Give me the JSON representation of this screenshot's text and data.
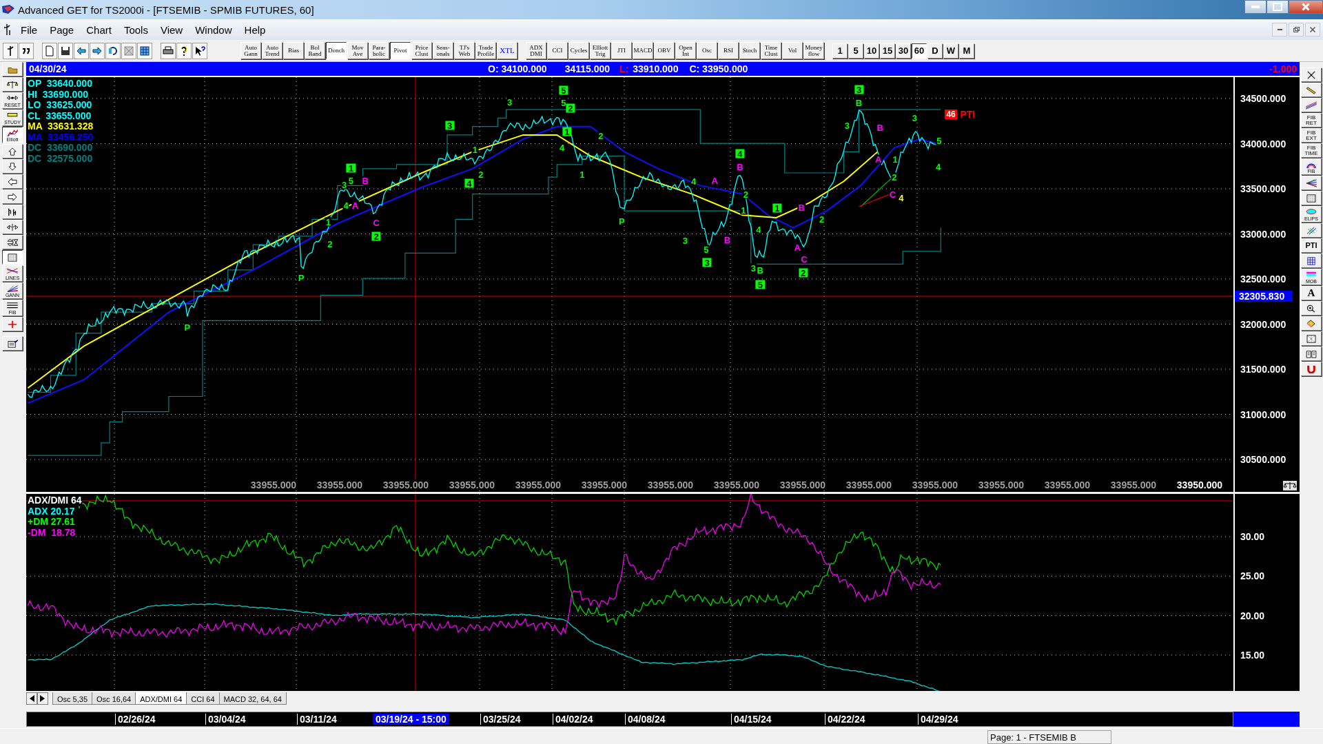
{
  "window": {
    "title": "Advanced GET for TS2000i - [FTSEMIB - SPMIB FUTURES, 60]"
  },
  "menu": [
    "File",
    "Page",
    "Chart",
    "Tools",
    "View",
    "Window",
    "Help"
  ],
  "toolbar": {
    "studies": [
      {
        "label": "Auto\nGann",
        "selected": false
      },
      {
        "label": "Auto\nTrend",
        "selected": false
      },
      {
        "label": "Bias",
        "selected": false
      },
      {
        "label": "Bol\nBand",
        "selected": false
      },
      {
        "label": "Donch",
        "selected": true
      },
      {
        "label": "Mov\nAve",
        "selected": false
      },
      {
        "label": "Para-\nbolic",
        "selected": false
      },
      {
        "label": "Pivot",
        "selected": true
      },
      {
        "label": "Price\nClust",
        "selected": false
      },
      {
        "label": "Seas-\nonals",
        "selected": false
      },
      {
        "label": "TJ's\nWeb",
        "selected": false
      },
      {
        "label": "Trade\nProfile",
        "selected": false
      },
      {
        "label": "XTL",
        "selected": false
      }
    ],
    "indicators": [
      {
        "label": "ADX\nDMI",
        "selected": false
      },
      {
        "label": "CCI",
        "selected": false
      },
      {
        "label": "Cycles",
        "selected": false
      },
      {
        "label": "Elliott\nTrig",
        "selected": false
      },
      {
        "label": "JTI",
        "selected": false
      },
      {
        "label": "MACD",
        "selected": false
      },
      {
        "label": "OBV",
        "selected": false
      },
      {
        "label": "Open\nInt",
        "selected": false
      },
      {
        "label": "Osc",
        "selected": false
      },
      {
        "label": "RSI",
        "selected": false
      },
      {
        "label": "Stoch",
        "selected": false
      },
      {
        "label": "Time\nClust",
        "selected": false
      },
      {
        "label": "Vol",
        "selected": false
      },
      {
        "label": "Money\nflow",
        "selected": false
      }
    ],
    "intervals": [
      {
        "label": "1",
        "selected": false
      },
      {
        "label": "5",
        "selected": false
      },
      {
        "label": "10",
        "selected": false
      },
      {
        "label": "15",
        "selected": false
      },
      {
        "label": "30",
        "selected": false
      },
      {
        "label": "60",
        "selected": true
      },
      {
        "label": "D",
        "selected": false
      },
      {
        "label": "W",
        "selected": false
      },
      {
        "label": "M",
        "selected": false
      }
    ]
  },
  "left_tools": [
    {
      "kind": "folder",
      "selected": false
    },
    {
      "kind": "scales",
      "selected": false
    },
    {
      "kind": "reset",
      "label": "RESET",
      "selected": false
    },
    {
      "kind": "study",
      "label": "STUDY",
      "selected": false
    },
    {
      "kind": "elliott",
      "label": "Elliott",
      "selected": true
    },
    {
      "kind": "up",
      "selected": false
    },
    {
      "kind": "down",
      "selected": false
    },
    {
      "kind": "left",
      "selected": false
    },
    {
      "kind": "right",
      "selected": false
    },
    {
      "kind": "bars",
      "selected": false
    },
    {
      "kind": "hsplit",
      "selected": false
    },
    {
      "kind": "vsplit",
      "selected": false
    },
    {
      "kind": "grid",
      "selected": true
    },
    {
      "kind": "lines",
      "label": "LINES",
      "selected": false
    },
    {
      "kind": "gann",
      "label": "GANN",
      "selected": false
    },
    {
      "kind": "fib",
      "label": "FIB",
      "selected": false
    },
    {
      "kind": "cross",
      "selected": false
    },
    {
      "kind": "notepad",
      "selected": false
    }
  ],
  "right_tools": [
    {
      "kind": "close"
    },
    {
      "kind": "pencil"
    },
    {
      "kind": "parallel"
    },
    {
      "kind": "text",
      "label": "FIB\nRET"
    },
    {
      "kind": "text",
      "label": "FIB\nEXT"
    },
    {
      "kind": "text",
      "label": "FIB\nTIME"
    },
    {
      "kind": "arc",
      "label": "FIB"
    },
    {
      "kind": "fan"
    },
    {
      "kind": "grid"
    },
    {
      "kind": "ellipse",
      "label": "ELIPS"
    },
    {
      "kind": "diagonal"
    },
    {
      "kind": "bold",
      "label": "PTI"
    },
    {
      "kind": "bluegrid"
    },
    {
      "kind": "mob",
      "label": "MOB"
    },
    {
      "kind": "bigtext",
      "label": "A"
    },
    {
      "kind": "zoom"
    },
    {
      "kind": "eraser"
    },
    {
      "kind": "pattern"
    },
    {
      "kind": "book"
    },
    {
      "kind": "magnet"
    }
  ],
  "info_bar": {
    "date": "04/30/24",
    "open": "O: 34100.000",
    "high": "34115.000",
    "low_label": "L:",
    "low": "33910.000",
    "close": "C: 33950.000",
    "change": "-1.000"
  },
  "price_panel": {
    "legend": [
      {
        "label": "OP",
        "value": "33640.000",
        "color": "#00ffff"
      },
      {
        "label": "HI",
        "value": "33690.000",
        "color": "#00ffff"
      },
      {
        "label": "LO",
        "value": "33625.000",
        "color": "#00ffff"
      },
      {
        "label": "CL",
        "value": "33655.000",
        "color": "#00ffff"
      },
      {
        "label": "MA",
        "value": "33631.328",
        "color": "#ffff00"
      },
      {
        "label": "MA",
        "value": "33456.250",
        "color": "#0000ff"
      },
      {
        "label": "DC",
        "value": "33690.000",
        "color": "#008080"
      },
      {
        "label": "DC",
        "value": "32575.000",
        "color": "#008080"
      }
    ],
    "y_axis": [
      "34500.000",
      "34000.000",
      "33500.000",
      "33000.000",
      "32500.000",
      "32000.000",
      "31500.000",
      "31000.000",
      "30500.000"
    ],
    "cursor_price": "32305.830",
    "bottom_values": [
      "33955.000",
      "33955.000",
      "33955.000",
      "33955.000",
      "33955.000",
      "33955.000",
      "33955.000",
      "33955.000",
      "33955.000",
      "33955.000",
      "33955.000",
      "33955.000",
      "33955.000",
      "33955.000",
      "33950.000"
    ],
    "wave_labels": [
      {
        "text": "5",
        "kind": "boxed",
        "color": "#00ff00"
      },
      {
        "text": "3",
        "kind": "boxed",
        "color": "#00ff00"
      },
      {
        "text": "3",
        "kind": "plain",
        "color": "#00ff00"
      },
      {
        "text": "5",
        "kind": "plain",
        "color": "#00ff00"
      },
      {
        "text": "2",
        "kind": "boxed",
        "color": "#00ff00"
      },
      {
        "text": "B",
        "kind": "plain",
        "color": "#00ff00"
      },
      {
        "text": "3",
        "kind": "plain",
        "color": "#00ff00"
      },
      {
        "text": "3",
        "kind": "boxed",
        "color": "#00ff00"
      },
      {
        "text": "1",
        "kind": "boxed",
        "color": "#00ff00"
      },
      {
        "text": "3",
        "kind": "plain",
        "color": "#00ff00"
      },
      {
        "text": "B",
        "kind": "plain",
        "color": "#ff00ff"
      },
      {
        "text": "2",
        "kind": "plain",
        "color": "#00ff00"
      },
      {
        "text": "1",
        "kind": "plain",
        "color": "#00ff00"
      },
      {
        "text": "4",
        "kind": "plain",
        "color": "#00ff00"
      },
      {
        "text": "5",
        "kind": "plain",
        "color": "#00ff00"
      },
      {
        "text": "4",
        "kind": "boxed",
        "color": "#00ff00"
      },
      {
        "text": "A",
        "kind": "plain",
        "color": "#ff00ff"
      },
      {
        "text": "1",
        "kind": "plain",
        "color": "#00ff00"
      },
      {
        "text": "1",
        "kind": "boxed",
        "color": "#00ff00"
      },
      {
        "text": "B",
        "kind": "plain",
        "color": "#ff00ff"
      },
      {
        "text": "4",
        "kind": "plain",
        "color": "#00ff00"
      },
      {
        "text": "2",
        "kind": "plain",
        "color": "#00ff00"
      },
      {
        "text": "1",
        "kind": "plain",
        "color": "#00ff00"
      },
      {
        "text": "2",
        "kind": "plain",
        "color": "#00ff00"
      },
      {
        "text": "3",
        "kind": "plain",
        "color": "#00ff00"
      },
      {
        "text": "5",
        "kind": "plain",
        "color": "#00ff00"
      },
      {
        "text": "B",
        "kind": "plain",
        "color": "#ff00ff"
      },
      {
        "text": "4",
        "kind": "boxed",
        "color": "#00ff00"
      },
      {
        "text": "4",
        "kind": "plain",
        "color": "#00ff00"
      },
      {
        "text": "A",
        "kind": "plain",
        "color": "#ff00ff"
      },
      {
        "text": "2",
        "kind": "plain",
        "color": "#00ff00"
      },
      {
        "text": "C",
        "kind": "plain",
        "color": "#ff00ff"
      },
      {
        "text": "4",
        "kind": "plain",
        "color": "#ffff00"
      },
      {
        "text": "4",
        "kind": "plain",
        "color": "#00ff00"
      },
      {
        "text": "A",
        "kind": "plain",
        "color": "#ff00ff"
      },
      {
        "text": "1",
        "kind": "plain",
        "color": "#00ff00"
      },
      {
        "text": "1",
        "kind": "boxed",
        "color": "#00ff00"
      },
      {
        "text": "B",
        "kind": "plain",
        "color": "#ff00ff"
      },
      {
        "text": "1",
        "kind": "plain",
        "color": "#00ff00"
      },
      {
        "text": "C",
        "kind": "plain",
        "color": "#ff00ff"
      },
      {
        "text": "P",
        "kind": "plain",
        "color": "#00ff00"
      },
      {
        "text": "2",
        "kind": "plain",
        "color": "#00ff00"
      },
      {
        "text": "4",
        "kind": "plain",
        "color": "#00ff00"
      },
      {
        "text": "2",
        "kind": "plain",
        "color": "#00ff00"
      },
      {
        "text": "2",
        "kind": "boxed",
        "color": "#00ff00"
      },
      {
        "text": "3",
        "kind": "plain",
        "color": "#00ff00"
      },
      {
        "text": "5",
        "kind": "plain",
        "color": "#00ff00"
      },
      {
        "text": "B",
        "kind": "plain",
        "color": "#ff00ff"
      },
      {
        "text": "A",
        "kind": "plain",
        "color": "#ff00ff"
      },
      {
        "text": "3",
        "kind": "boxed",
        "color": "#00ff00"
      },
      {
        "text": "3",
        "kind": "plain",
        "color": "#00ff00"
      },
      {
        "text": "B",
        "kind": "plain",
        "color": "#00ff00"
      },
      {
        "text": "C",
        "kind": "plain",
        "color": "#ff00ff"
      },
      {
        "text": "2",
        "kind": "boxed",
        "color": "#00ff00"
      },
      {
        "text": "P",
        "kind": "plain",
        "color": "#00ff00"
      },
      {
        "text": "5",
        "kind": "boxed",
        "color": "#00ff00"
      },
      {
        "text": "P",
        "kind": "plain",
        "color": "#00ff00"
      }
    ],
    "pti": {
      "count": "46",
      "label": "PTI"
    }
  },
  "indicator_panel": {
    "legend": [
      {
        "text": "ADX/DMI 64",
        "color": "#ffffff"
      },
      {
        "text": "ADX 20.17",
        "color": "#00ffff"
      },
      {
        "text": "+DM 27.61",
        "color": "#00ff00"
      },
      {
        "text": "-DM  18.78",
        "color": "#ff00ff"
      }
    ],
    "y_axis": [
      "30.00",
      "25.00",
      "20.00",
      "15.00"
    ]
  },
  "panel_tabs": [
    {
      "label": "Osc 5,35",
      "selected": false
    },
    {
      "label": "Osc 16,64",
      "selected": false
    },
    {
      "label": "ADX/DMI 64",
      "selected": true
    },
    {
      "label": "CCI 64",
      "selected": false
    },
    {
      "label": "MACD 32, 64, 64",
      "selected": false
    }
  ],
  "dates": [
    {
      "text": "02/26/24",
      "selected": false
    },
    {
      "text": "03/04/24",
      "selected": false
    },
    {
      "text": "03/11/24",
      "selected": false
    },
    {
      "text": "03/19/24 - 15:00",
      "selected": true
    },
    {
      "text": "03/25/24",
      "selected": false
    },
    {
      "text": "04/02/24",
      "selected": false
    },
    {
      "text": "04/08/24",
      "selected": false
    },
    {
      "text": "04/15/24",
      "selected": false
    },
    {
      "text": "04/22/24",
      "selected": false
    },
    {
      "text": "04/29/24",
      "selected": false
    }
  ],
  "status_bar": {
    "page": "Page: 1 - FTSEMIB B"
  }
}
